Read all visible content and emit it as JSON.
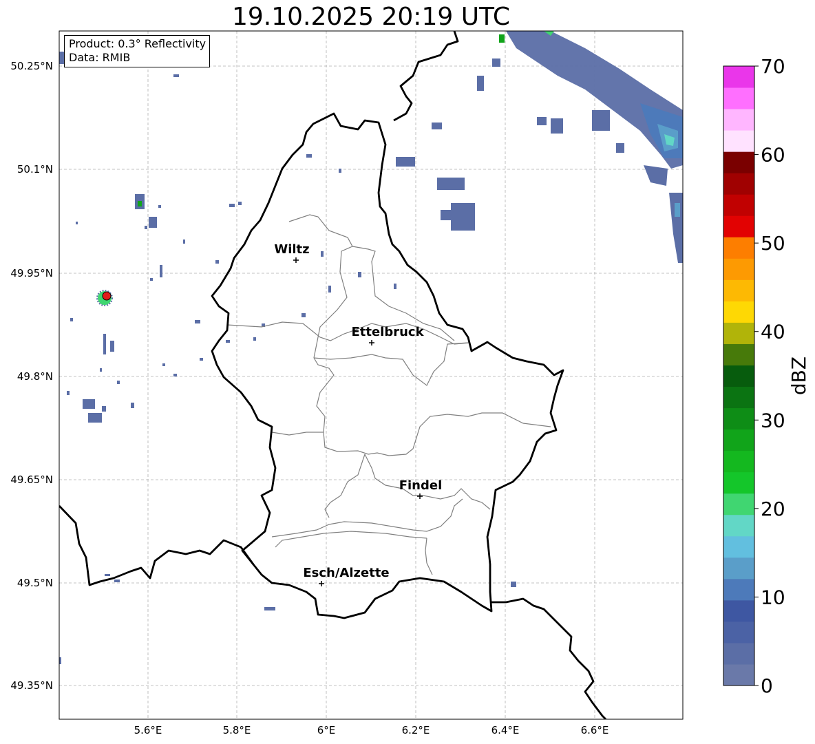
{
  "title": "19.10.2025 20:19 UTC",
  "info": {
    "product": "Product: 0.3° Reflectivity",
    "data": "Data: RMIB"
  },
  "axes": {
    "lat_labels": [
      "50.25°N",
      "50.1°N",
      "49.95°N",
      "49.8°N",
      "49.65°N",
      "49.5°N",
      "49.35°N"
    ],
    "lon_labels": [
      "5.6°E",
      "5.8°E",
      "6°E",
      "6.2°E",
      "6.4°E",
      "6.6°E"
    ]
  },
  "cities": [
    {
      "name": "Wiltz"
    },
    {
      "name": "Ettelbruck"
    },
    {
      "name": "Findel"
    },
    {
      "name": "Esch/Alzette"
    }
  ],
  "colorbar": {
    "label": "dBZ",
    "ticks": [
      "0",
      "10",
      "20",
      "30",
      "40",
      "50",
      "60",
      "70"
    ],
    "colors": [
      "#6a79a9",
      "#5b6ea6",
      "#4b62a5",
      "#3e57a2",
      "#4d7aba",
      "#5a9ec9",
      "#62bfdf",
      "#62d7c6",
      "#40d671",
      "#14c62a",
      "#14b81f",
      "#11a41a",
      "#0e8d16",
      "#0b7412",
      "#075c0d",
      "#477a0a",
      "#b1b409",
      "#fed804",
      "#fdb903",
      "#fd9a02",
      "#fd7e00",
      "#e20202",
      "#c10101",
      "#a00101",
      "#7a0000",
      "#ffe2ff",
      "#ffb6ff",
      "#ff6fff",
      "#ea36ea"
    ]
  },
  "colors": {
    "national_border": "#000000",
    "canton_border": "#808080",
    "grid": "#b0b0b0",
    "radar_low": "#5b6ea6"
  }
}
